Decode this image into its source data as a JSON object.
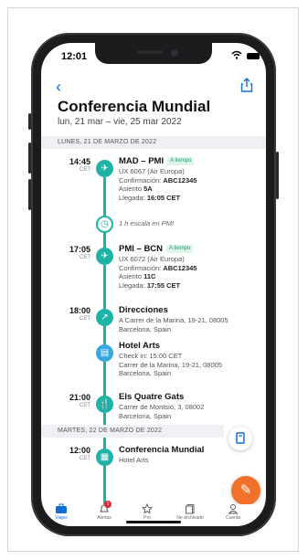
{
  "status": {
    "time": "12:01"
  },
  "trip": {
    "title": "Conferencia Mundial",
    "dates": "lun, 21 mar – vie, 25 mar 2022"
  },
  "days": [
    {
      "header": "LUNES, 21 DE MARZO DE 2022"
    },
    {
      "header": "MARTES, 22 DE MARZO DE 2022"
    }
  ],
  "events": [
    {
      "time": "14:45",
      "tz": "CET",
      "title": "MAD – PMI",
      "badge": "A tiempo",
      "lines": [
        "UX 6067 (Air Europa)",
        "Confirmación: ",
        "Asiento ",
        "Llegada: "
      ],
      "conf": "ABC12345",
      "seat": "5A",
      "arrival": "16:05 CET"
    },
    {
      "layover": "1 h escala en PMI"
    },
    {
      "time": "17:05",
      "tz": "CET",
      "title": "PMI – BCN",
      "badge": "A tiempo",
      "lines": [
        "UX 6072 (Air Europa)",
        "Confirmación: ",
        "Asiento ",
        "Llegada: "
      ],
      "conf": "ABC12345",
      "seat": "11C",
      "arrival": "17:55 CET"
    },
    {
      "time": "18:00",
      "tz": "CET",
      "title": "Direcciones",
      "l1": "A Carrer de la Marina, 19-21, 08005",
      "l2": "Barcelona, Spain"
    },
    {
      "title": "Hotel Arts",
      "l1": "Check in: 15:00 CET",
      "l2": "Carrer de la Marina, 19-21, 08005",
      "l3": "Barcelona, Spain"
    },
    {
      "time": "21:00",
      "tz": "CET",
      "title": "Els Quatre Gats",
      "l1": "Carrer de Montsió, 3, 08002",
      "l2": "Barcelona, Spain"
    },
    {
      "time": "12:00",
      "tz": "CET",
      "title": "Conferencia Mundial",
      "l1": "Hotel Arts"
    }
  ],
  "tabs": [
    {
      "label": "Viajes",
      "icon": "suitcase-icon"
    },
    {
      "label": "Alertas",
      "icon": "bell-icon",
      "count": "1"
    },
    {
      "label": "Pro",
      "icon": "star-icon"
    },
    {
      "label": "Ne archivado",
      "icon": "archive-icon"
    },
    {
      "label": "Cuenta",
      "icon": "person-icon"
    }
  ],
  "colors": {
    "accent": "#0d6fd6",
    "timeline": "#1db3a6",
    "fab": "#f0722a"
  }
}
